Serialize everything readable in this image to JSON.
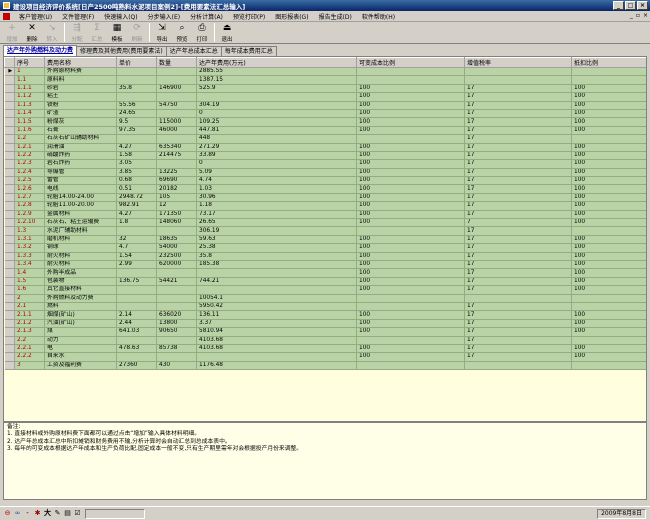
{
  "window": {
    "title": "建设项目经济评价系统[日产2500吨熟料水泥项目案例2]-[费用要素法汇总输入]"
  },
  "menu": [
    "客户管理(U)",
    "文件管理(F)",
    "快速输入(Q)",
    "分步输入(E)",
    "分析计算(A)",
    "预览打印(P)",
    "图形报表(G)",
    "报告生成(D)",
    "软件帮助(H)"
  ],
  "toolbar": [
    {
      "label": "增加",
      "icon": "add-icon",
      "glyph": "+",
      "enabled": false
    },
    {
      "label": "删除",
      "icon": "delete-icon",
      "glyph": "✕",
      "enabled": true
    },
    {
      "label": "转入",
      "icon": "import-icon",
      "glyph": "↘",
      "enabled": false
    },
    {
      "label": "分配",
      "icon": "distribute-icon",
      "glyph": "⇶",
      "enabled": false
    },
    {
      "label": "汇总",
      "icon": "sum-icon",
      "glyph": "Σ",
      "enabled": false
    },
    {
      "label": "模板",
      "icon": "template-icon",
      "glyph": "▦",
      "enabled": true
    },
    {
      "label": "刷新",
      "icon": "refresh-icon",
      "glyph": "⟳",
      "enabled": false
    },
    {
      "label": "导出",
      "icon": "export-icon",
      "glyph": "⇲",
      "enabled": true
    },
    {
      "label": "预览",
      "icon": "preview-icon",
      "glyph": "⌕",
      "enabled": true
    },
    {
      "label": "打印",
      "icon": "print-icon",
      "glyph": "⎙",
      "enabled": true
    },
    {
      "label": "退出",
      "icon": "exit-icon",
      "glyph": "⏏",
      "enabled": true
    }
  ],
  "tabs": [
    "达产年外购燃料及动力费",
    "修理费及其他费用(费用要素法)",
    "达产年总成本汇总",
    "每年成本费用汇总"
  ],
  "table": {
    "headers": [
      "",
      "序号",
      "费用名称",
      "单价",
      "数量",
      "达产年费用(万元)",
      "可变成本比例",
      "增值税率",
      "抵扣比例"
    ],
    "rows": [
      [
        "1",
        "外购原材料费",
        "",
        "",
        "2885.55",
        "",
        "",
        ""
      ],
      [
        "1.1",
        "原料料",
        "",
        "",
        "1387.15",
        "",
        "",
        ""
      ],
      [
        "1.1.1",
        "砂岩",
        "35.8",
        "146900",
        "525.9",
        "100",
        "17",
        "100"
      ],
      [
        "1.1.2",
        "粘土",
        "",
        "",
        "",
        "100",
        "17",
        "100"
      ],
      [
        "1.1.3",
        "铁粉",
        "55.56",
        "54750",
        "304.19",
        "100",
        "17",
        "100"
      ],
      [
        "1.1.4",
        "矿渣",
        "24.65",
        "",
        "0",
        "100",
        "17",
        "100"
      ],
      [
        "1.1.5",
        "粉煤灰",
        "9.5",
        "115000",
        "109.25",
        "100",
        "17",
        "100"
      ],
      [
        "1.1.6",
        "石膏",
        "97.35",
        "46000",
        "447.81",
        "100",
        "17",
        "100"
      ],
      [
        "1.2",
        "石灰石矿山辅助材料",
        "",
        "",
        "448",
        "",
        "17",
        ""
      ],
      [
        "1.2.1",
        "润滑油",
        "4.27",
        "635340",
        "271.29",
        "100",
        "17",
        "100"
      ],
      [
        "1.2.2",
        "硝酸炸药",
        "1.58",
        "214475",
        "33.89",
        "100",
        "17",
        "100"
      ],
      [
        "1.2.3",
        "岩石炸药",
        "3.05",
        "",
        "0",
        "100",
        "17",
        "100"
      ],
      [
        "1.2.4",
        "导爆管",
        "3.85",
        "13225",
        "5.09",
        "100",
        "17",
        "100"
      ],
      [
        "1.2.5",
        "雷管",
        "0.68",
        "69690",
        "4.74",
        "100",
        "17",
        "100"
      ],
      [
        "1.2.6",
        "电线",
        "0.51",
        "20182",
        "1.03",
        "100",
        "17",
        "100"
      ],
      [
        "1.2.7",
        "轮胎14.00-24.00",
        "2948.72",
        "105",
        "30.96",
        "100",
        "17",
        "100"
      ],
      [
        "1.2.8",
        "轮胎11.00-20.00",
        "982.91",
        "12",
        "1.18",
        "100",
        "17",
        "100"
      ],
      [
        "1.2.9",
        "金属材料",
        "4.27",
        "171350",
        "73.17",
        "100",
        "17",
        "100"
      ],
      [
        "1.2.10",
        "石灰石、粘土运输费",
        "1.8",
        "148060",
        "26.65",
        "100",
        "7",
        "100"
      ],
      [
        "1.3",
        "水泥厂辅助材料",
        "",
        "",
        "306.19",
        "",
        "17",
        ""
      ],
      [
        "1.3.1",
        "磨机材料",
        "32",
        "18635",
        "59.63",
        "100",
        "17",
        "100"
      ],
      [
        "1.3.2",
        "钢球",
        "4.7",
        "54000",
        "25.38",
        "100",
        "17",
        "100"
      ],
      [
        "1.3.3",
        "耐火材料",
        "1.54",
        "232500",
        "35.8",
        "100",
        "17",
        "100"
      ],
      [
        "1.3.4",
        "耐火材料",
        "2.99",
        "620000",
        "185.38",
        "100",
        "17",
        "100"
      ],
      [
        "1.4",
        "外购半成品",
        "",
        "",
        "",
        "100",
        "17",
        "100"
      ],
      [
        "1.5",
        "包装物",
        "136.75",
        "54421",
        "744.21",
        "100",
        "17",
        "100"
      ],
      [
        "1.6",
        "其它直接材料",
        "",
        "",
        "",
        "100",
        "17",
        "100"
      ],
      [
        "2",
        "外购燃料及动力费",
        "",
        "",
        "10054.1",
        "",
        "",
        ""
      ],
      [
        "2.1",
        "燃料",
        "",
        "",
        "5950.42",
        "",
        "17",
        ""
      ],
      [
        "2.1.1",
        "烟煤(矿山)",
        "2.14",
        "636020",
        "136.11",
        "100",
        "17",
        "100"
      ],
      [
        "2.1.2",
        "汽油(矿山)",
        "2.44",
        "13800",
        "3.37",
        "100",
        "17",
        "100"
      ],
      [
        "2.1.3",
        "煤",
        "641.03",
        "90650",
        "5810.94",
        "100",
        "17",
        "100"
      ],
      [
        "2.2",
        "动力",
        "",
        "",
        "4103.68",
        "",
        "17",
        ""
      ],
      [
        "2.2.1",
        "电",
        "478.63",
        "85738",
        "4103.68",
        "100",
        "17",
        "100"
      ],
      [
        "2.2.2",
        "自来水",
        "",
        "",
        "",
        "100",
        "17",
        "100"
      ],
      [
        "3",
        "工资及福利费",
        "27360",
        "430",
        "1176.48",
        "",
        "",
        ""
      ]
    ]
  },
  "notes": [
    "备注:",
    "1. 直接材料或外购原材料费下面都可以通过点击“增加”输入具体材料明细。",
    "2. 达产年总成本汇总中所扣摊销和财务费用不输,分析计算时会自动汇总到总成本表中。",
    "3. 每年的可变成本根据达产年成本和生产负荷比配,固定成本一般不变,只有生产期里需年对会根据投产月份来调整。"
  ],
  "status": {
    "date": "2009年8月8日"
  }
}
